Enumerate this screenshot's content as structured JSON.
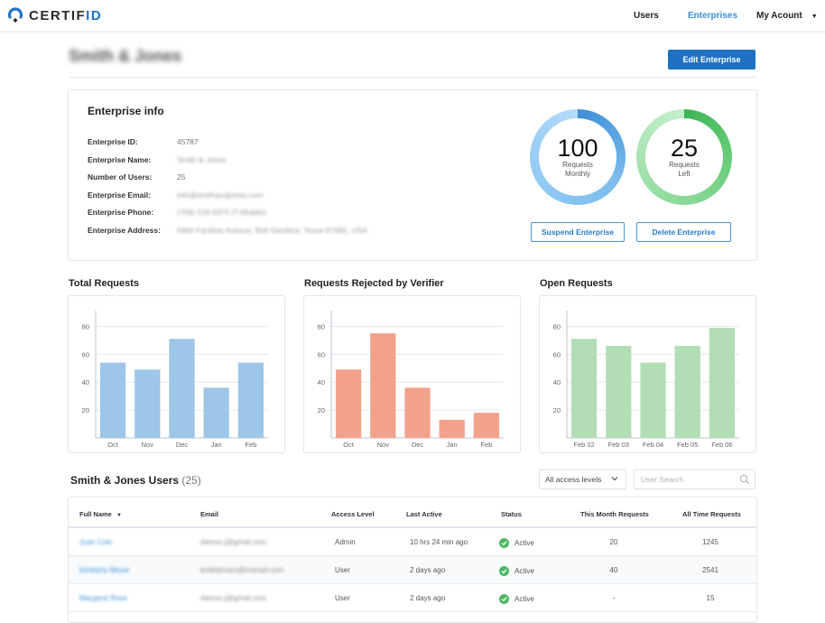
{
  "app": {
    "logo_text_main": "CERTIF",
    "logo_text_accent": "ID",
    "brand_color": "#1f72c3"
  },
  "nav": {
    "users": "Users",
    "enterprises": "Enterprises",
    "my_account": "My Acount",
    "caret": "▼"
  },
  "header": {
    "title": "Smith & Jones",
    "edit_button": "Edit Enterprise"
  },
  "enterprise_info": {
    "title": "Enterprise info",
    "fields": [
      {
        "label": "Enterprise ID:",
        "value": "45787"
      },
      {
        "label": "Enterprise Name:",
        "value": "Smith & Johes"
      },
      {
        "label": "Number of Users:",
        "value": "25"
      },
      {
        "label": "Enterprise Email:",
        "value": "info@smithandjones.com"
      },
      {
        "label": "Enterprise Phone:",
        "value": "(759) 516-6375 (T-Mobile)"
      },
      {
        "label": "Enterprise Address:",
        "value": "5964 Facilisis Avenue, Bell Gardens, Texas 87065, USA"
      }
    ],
    "ring_monthly": {
      "value": "100",
      "label_line1": "Requests",
      "label_line2": "Monthly",
      "color": "#3f8fd6"
    },
    "ring_left": {
      "value": "25",
      "label_line1": "Requests",
      "label_line2": "Left",
      "color": "#3cb454"
    },
    "suspend_button": "Suspend Enterprise",
    "delete_button": "Delete Enterprise"
  },
  "chart_data": [
    {
      "type": "bar",
      "title": "Total Requests",
      "categories": [
        "Oct",
        "Nov",
        "Dec",
        "Jan",
        "Feb"
      ],
      "values": [
        54,
        49,
        71,
        36,
        54
      ],
      "yticks": [
        "20",
        "40",
        "60",
        "80"
      ],
      "ylim": [
        0,
        90
      ],
      "xlabel": "",
      "ylabel": "",
      "grid": true,
      "color": "#9dc6e8"
    },
    {
      "type": "bar",
      "title": "Requests Rejected by Verifier",
      "categories": [
        "Oct",
        "Nov",
        "Dec",
        "Jan",
        "Feb"
      ],
      "values": [
        49,
        75,
        36,
        13,
        18
      ],
      "yticks": [
        "20",
        "40",
        "60",
        "80"
      ],
      "ylim": [
        0,
        90
      ],
      "xlabel": "",
      "ylabel": "",
      "grid": true,
      "color": "#f2a28a"
    },
    {
      "type": "bar",
      "title": "Open Requests",
      "categories": [
        "Feb 02",
        "Feb 03",
        "Feb 04",
        "Feb 05",
        "Feb 06"
      ],
      "values": [
        71,
        66,
        54,
        66,
        79
      ],
      "yticks": [
        "20",
        "40",
        "60",
        "80"
      ],
      "ylim": [
        0,
        90
      ],
      "xlabel": "",
      "ylabel": "",
      "grid": true,
      "color": "#b2ddb5"
    }
  ],
  "users": {
    "title": "Smith & Jones Users",
    "count": "(25)",
    "filter_selected": "All access levels",
    "search_placeholder": "User Search",
    "columns": [
      "Full Name",
      "Email",
      "Access Level",
      "Last Active",
      "Status",
      "This Month Requests",
      "All Time  Requests"
    ],
    "rows": [
      {
        "name": "Juan Cole",
        "email": "damon.j@gmail.com",
        "access": "Admin",
        "last_active": "10 hrs 24 min ago",
        "status": "Active",
        "month": "20",
        "all_time": "1245"
      },
      {
        "name": "Kimberly Meyer",
        "email": "kmithbrown@hotmail.com",
        "access": "User",
        "last_active": "2 days ago",
        "status": "Active",
        "month": "40",
        "all_time": "2541"
      },
      {
        "name": "Margaret Rose",
        "email": "damon.j@gmail.com",
        "access": "User",
        "last_active": "2 days ago",
        "status": "Active",
        "month": "-",
        "all_time": "15"
      }
    ]
  }
}
